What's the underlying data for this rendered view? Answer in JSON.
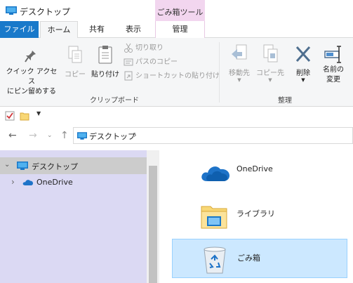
{
  "window": {
    "title": "デスクトップ"
  },
  "context_tab": {
    "header": "ごみ箱ツール",
    "tab_label": "管理"
  },
  "tabs": {
    "file": "ファイル",
    "home": "ホーム",
    "share": "共有",
    "view": "表示"
  },
  "ribbon": {
    "pin_quick_access": "クイック アクセス\nにピン留めする",
    "copy": "コピー",
    "paste": "貼り付け",
    "cut": "切り取り",
    "copy_path": "パスのコピー",
    "paste_shortcut": "ショートカットの貼り付け",
    "clipboard_group": "クリップボード",
    "move_to": "移動先",
    "copy_to": "コピー先",
    "delete": "削除",
    "rename": "名前の\n変更",
    "organize_group": "整理"
  },
  "address": {
    "path": "デスクトップ"
  },
  "nav_pane": {
    "items": [
      {
        "label": "デスクトップ"
      },
      {
        "label": "OneDrive"
      }
    ]
  },
  "content": {
    "items": [
      {
        "label": "OneDrive"
      },
      {
        "label": "ライブラリ"
      },
      {
        "label": "ごみ箱"
      }
    ]
  },
  "colors": {
    "file_tab": "#1979ca",
    "context_tab": "#f2d6ef",
    "nav_pane": "#dbd9f3",
    "selection": "#cce8ff"
  }
}
